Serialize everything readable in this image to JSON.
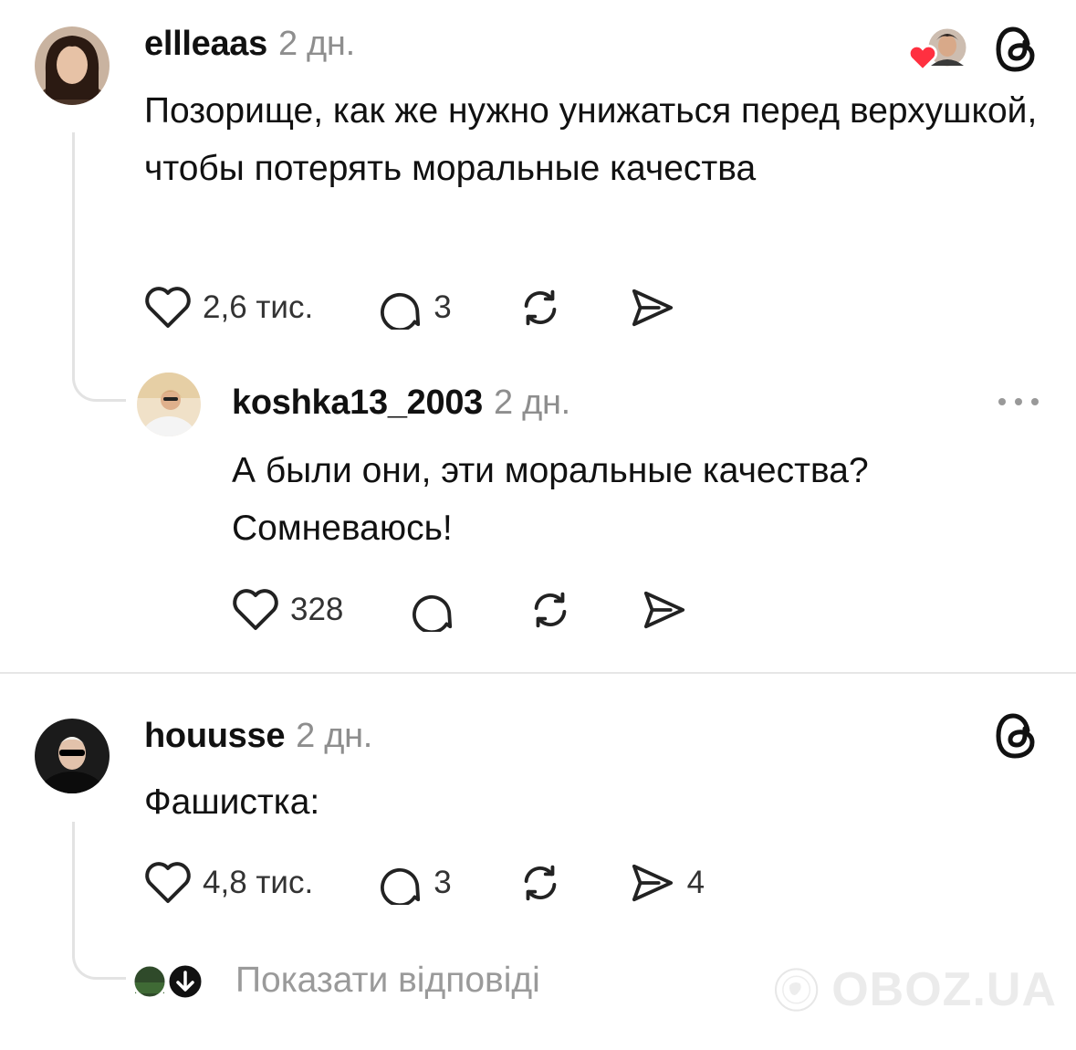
{
  "colors": {
    "like_red": "#ff3040",
    "text": "#111111",
    "muted": "#8e8e8e",
    "line": "#e3e3e3"
  },
  "comments": [
    {
      "username": "ellleaas",
      "time": "2 дн.",
      "text": "Позорище, как же нужно унижаться перед верхушкой, чтобы потерять моральные качества",
      "likes": "2,6 тис.",
      "replies": "3",
      "badge_icon": "threads-icon",
      "liked_by_author_icon": "heart-avatar-icon"
    },
    {
      "username": "koshka13_2003",
      "time": "2 дн.",
      "text": "А были они, эти моральные качества? Сомневаюсь!",
      "likes": "328",
      "more_icon": "more-icon"
    },
    {
      "username": "houusse",
      "time": "2 дн.",
      "text": "Фашистка:",
      "likes": "4,8 тис.",
      "replies": "3",
      "shares": "4",
      "badge_icon": "threads-icon"
    }
  ],
  "show_replies": "Показати відповіді",
  "watermark": "OBOZ.UA"
}
